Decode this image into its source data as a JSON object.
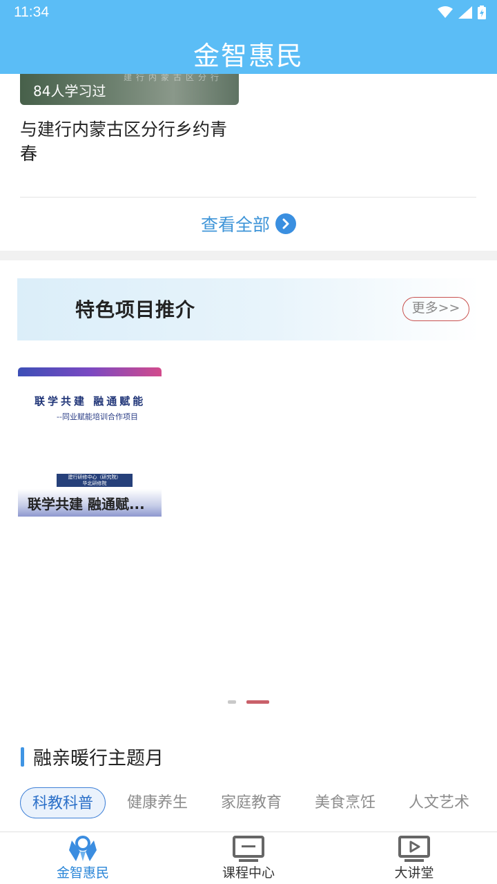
{
  "status": {
    "time": "11:34"
  },
  "header": {
    "title": "金智惠民"
  },
  "course_card": {
    "learned_count": "84人学习过",
    "title": "与建行内蒙古区分行乡约青春"
  },
  "view_all": {
    "label": "查看全部"
  },
  "featured": {
    "title": "特色项目推介",
    "more_label": "更多>>",
    "project": {
      "calligraphy": "联学共建 融通赋能",
      "subtitle": "--同业赋能培训合作项目",
      "badge_line1": "建行研修中心（研究院）",
      "badge_line2": "华北研修院",
      "name": "联学共建 融通赋..."
    },
    "pager": {
      "count": 2,
      "active_index": 1
    }
  },
  "theme_month": {
    "title": "融亲暖行主题月",
    "tabs": [
      "科教科普",
      "健康养生",
      "家庭教育",
      "美食烹饪",
      "人文艺术"
    ],
    "active_tab": 0
  },
  "bottom_nav": {
    "items": [
      {
        "label": "金智惠民",
        "icon": "jinzhi-logo-icon",
        "active": true
      },
      {
        "label": "课程中心",
        "icon": "monitor-icon",
        "active": false
      },
      {
        "label": "大讲堂",
        "icon": "video-play-icon",
        "active": false
      }
    ]
  },
  "colors": {
    "header_bg": "#5bbdf6",
    "accent_blue": "#3a8fe0",
    "more_border": "#c8504e",
    "pager_active": "#c9606a"
  }
}
